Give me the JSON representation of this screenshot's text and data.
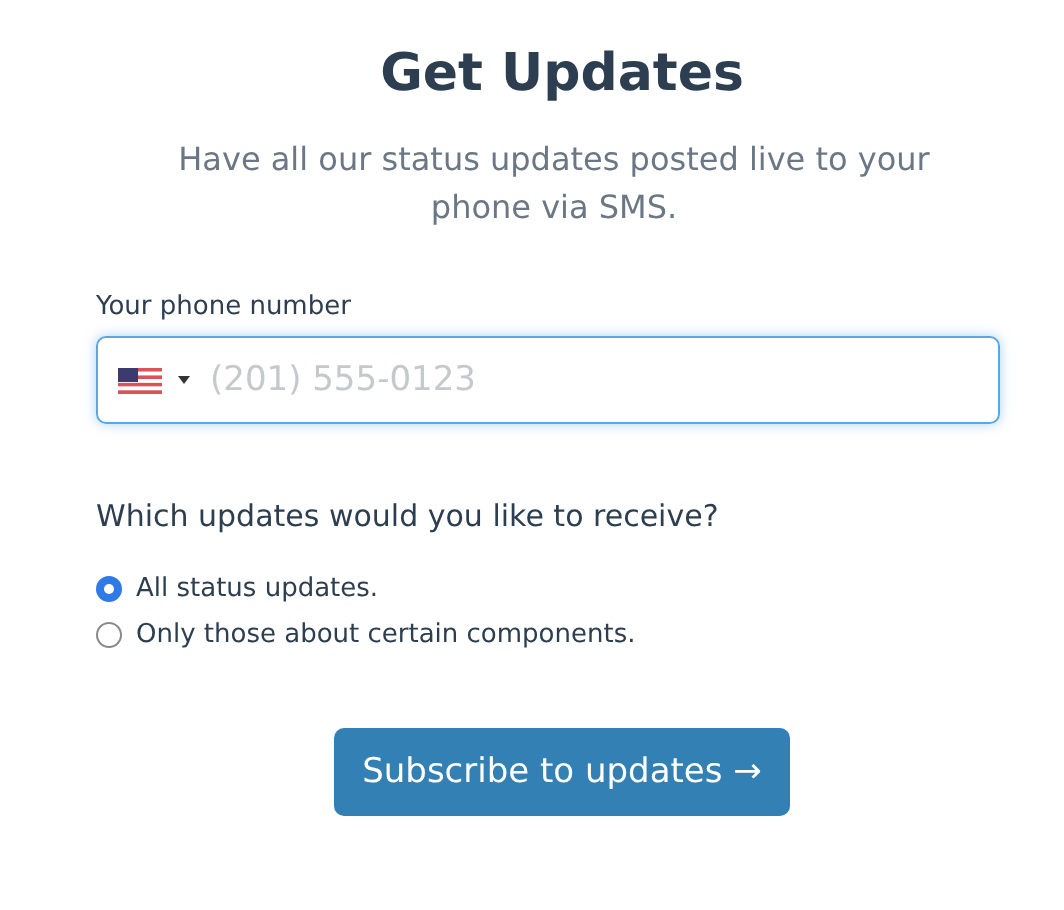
{
  "title": "Get Updates",
  "subtitle": "Have all our status updates posted live to your phone via SMS.",
  "phone": {
    "label": "Your phone number",
    "placeholder": "(201) 555-0123",
    "focused": true
  },
  "question": "Which updates would you like to receive?",
  "options": [
    {
      "label": "All status updates.",
      "selected": true
    },
    {
      "label": "Only those about certain components.",
      "selected": false
    }
  ],
  "submit": "Subscribe to updates →"
}
